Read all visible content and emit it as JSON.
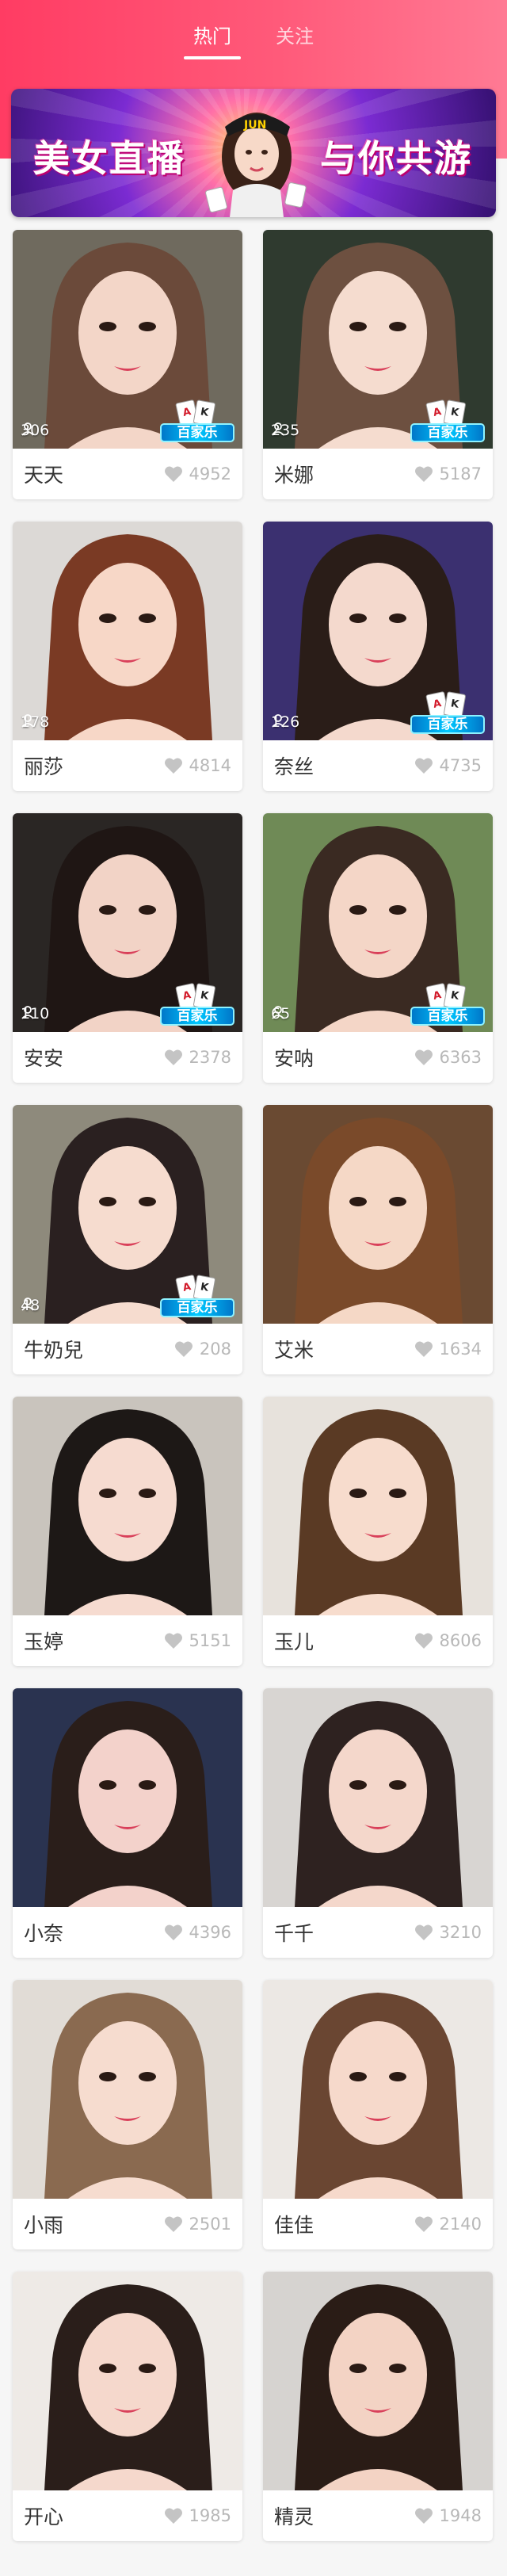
{
  "tabs": [
    {
      "label": "热门",
      "active": true
    },
    {
      "label": "关注",
      "active": false
    }
  ],
  "banner": {
    "left_text": "美女直播",
    "right_text": "与你共游",
    "cap_text": "JUN"
  },
  "badge_text": "百家乐",
  "cards": [
    {
      "name": "天天",
      "likes": "4952",
      "viewers": "306",
      "badge": true,
      "bg": "#6f6a5e",
      "hair": "#6b4a3a",
      "skin": "#f3d6c8"
    },
    {
      "name": "米娜",
      "likes": "5187",
      "viewers": "235",
      "badge": true,
      "bg": "#2f3a2f",
      "hair": "#6d5040",
      "skin": "#f5dccf"
    },
    {
      "name": "丽莎",
      "likes": "4814",
      "viewers": "178",
      "badge": false,
      "bg": "#dcd9d6",
      "hair": "#7a3a24",
      "skin": "#f7d7c7"
    },
    {
      "name": "奈丝",
      "likes": "4735",
      "viewers": "126",
      "badge": true,
      "bg": "#3b3070",
      "hair": "#2a1d18",
      "skin": "#f4d9cd"
    },
    {
      "name": "安安",
      "likes": "2378",
      "viewers": "110",
      "badge": true,
      "bg": "#2a2624",
      "hair": "#1f1614",
      "skin": "#f2d3c6"
    },
    {
      "name": "安呐",
      "likes": "6363",
      "viewers": "65",
      "badge": true,
      "bg": "#6f8a56",
      "hair": "#3a2a22",
      "skin": "#f4d6c7"
    },
    {
      "name": "牛奶兒",
      "likes": "208",
      "viewers": "48",
      "badge": true,
      "bg": "#8e8a7c",
      "hair": "#2a2020",
      "skin": "#f6dccf"
    },
    {
      "name": "艾米",
      "likes": "1634",
      "viewers": "",
      "badge": false,
      "bg": "#6a4a32",
      "hair": "#7a4a2a",
      "skin": "#f5d8c6"
    },
    {
      "name": "玉婷",
      "likes": "5151",
      "viewers": "",
      "badge": false,
      "bg": "#c9c4bd",
      "hair": "#1d1816",
      "skin": "#f6dbd0"
    },
    {
      "name": "玉儿",
      "likes": "8606",
      "viewers": "",
      "badge": false,
      "bg": "#e7e2dc",
      "hair": "#5a3a24",
      "skin": "#f7dccd"
    },
    {
      "name": "小奈",
      "likes": "4396",
      "viewers": "",
      "badge": false,
      "bg": "#2a3350",
      "hair": "#2a1e1a",
      "skin": "#f3d2cb"
    },
    {
      "name": "千千",
      "likes": "3210",
      "viewers": "",
      "badge": false,
      "bg": "#d8d5d2",
      "hair": "#2e2220",
      "skin": "#f4d7cb"
    },
    {
      "name": "小雨",
      "likes": "2501",
      "viewers": "",
      "badge": false,
      "bg": "#e1dcd6",
      "hair": "#8a6a50",
      "skin": "#f6dccf"
    },
    {
      "name": "佳佳",
      "likes": "2140",
      "viewers": "",
      "badge": false,
      "bg": "#ece8e4",
      "hair": "#6a4632",
      "skin": "#f6d9cb"
    },
    {
      "name": "开心",
      "likes": "1985",
      "viewers": "",
      "badge": false,
      "bg": "#eeeae6",
      "hair": "#2a1e1a",
      "skin": "#f5d8cc"
    },
    {
      "name": "精灵",
      "likes": "1948",
      "viewers": "",
      "badge": false,
      "bg": "#d6d3d0",
      "hair": "#2a1c16",
      "skin": "#f3d3c4"
    }
  ]
}
